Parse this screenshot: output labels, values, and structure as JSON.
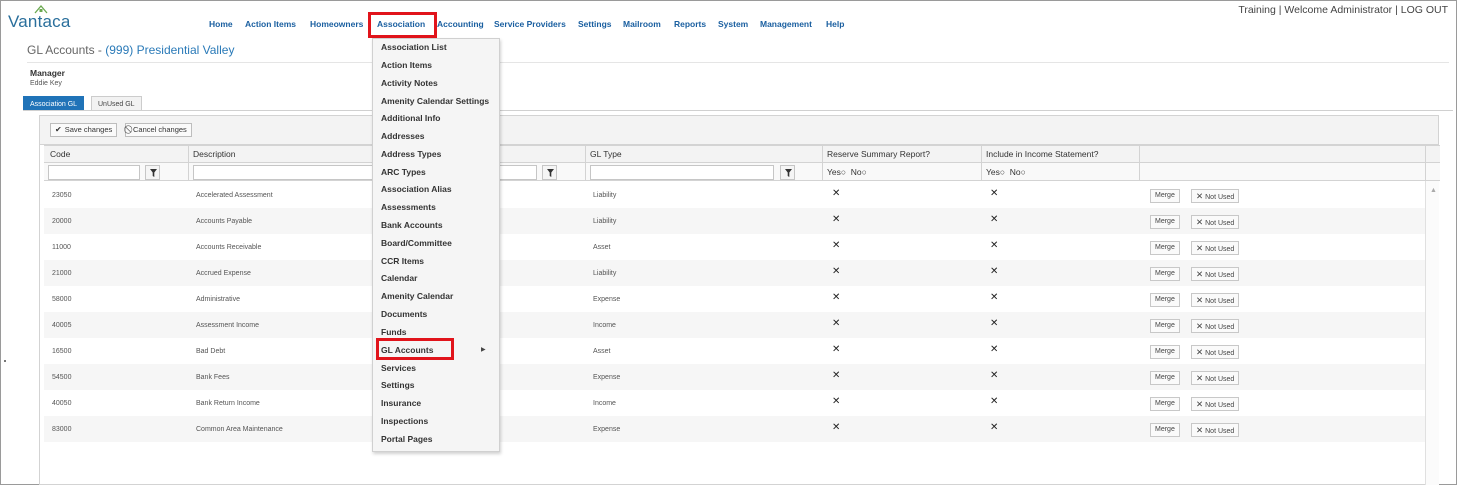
{
  "app": {
    "logo_text": "Vantaca"
  },
  "nav": {
    "items": [
      "Home",
      "Action Items",
      "Homeowners",
      "Association",
      "Accounting",
      "Service Providers",
      "Settings",
      "Mailroom",
      "Reports",
      "System",
      "Management",
      "Help"
    ],
    "active": "Association"
  },
  "user_bar": {
    "text": "Training | Welcome Administrator | LOG OUT"
  },
  "page": {
    "title_prefix": "GL Accounts - ",
    "association": "(999) Presidential Valley",
    "manager_label": "Manager",
    "manager_name": "Eddie Key"
  },
  "tabs": [
    "Association GL",
    "UnUsed GL"
  ],
  "toolbar": {
    "save_label": "Save changes",
    "cancel_label": "Cancel changes"
  },
  "grid": {
    "columns": [
      "Code",
      "Description",
      "GL Type",
      "Reserve Summary Report?",
      "Include in Income Statement?"
    ],
    "radio_yes": "Yes",
    "radio_no": "No",
    "merge_label": "Merge",
    "not_used_label": "Not Used",
    "rows": [
      {
        "code": "23050",
        "description": "Accelerated Assessment",
        "gl_type": "Liability",
        "reserve": "✕",
        "income": "✕"
      },
      {
        "code": "20000",
        "description": "Accounts Payable",
        "gl_type": "Liability",
        "reserve": "✕",
        "income": "✕"
      },
      {
        "code": "11000",
        "description": "Accounts Receivable",
        "gl_type": "Asset",
        "reserve": "✕",
        "income": "✕"
      },
      {
        "code": "21000",
        "description": "Accrued Expense",
        "gl_type": "Liability",
        "reserve": "✕",
        "income": "✕"
      },
      {
        "code": "58000",
        "description": "Administrative",
        "gl_type": "Expense",
        "reserve": "✕",
        "income": "✕"
      },
      {
        "code": "40005",
        "description": "Assessment Income",
        "gl_type": "Income",
        "reserve": "✕",
        "income": "✕"
      },
      {
        "code": "16500",
        "description": "Bad Debt",
        "gl_type": "Asset",
        "reserve": "✕",
        "income": "✕"
      },
      {
        "code": "54500",
        "description": "Bank Fees",
        "gl_type": "Expense",
        "reserve": "✕",
        "income": "✕"
      },
      {
        "code": "40050",
        "description": "Bank Return Income",
        "gl_type": "Income",
        "reserve": "✕",
        "income": "✕"
      },
      {
        "code": "83000",
        "description": "Common Area Maintenance",
        "gl_type": "Expense",
        "reserve": "✕",
        "income": "✕"
      }
    ]
  },
  "association_menu": {
    "items": [
      "Association List",
      "Action Items",
      "Activity Notes",
      "Amenity Calendar Settings",
      "Additional Info",
      "Addresses",
      "Address Types",
      "ARC Types",
      "Association Alias",
      "Assessments",
      "Bank Accounts",
      "Board/Committee",
      "CCR Items",
      "Calendar",
      "Amenity Calendar",
      "Documents",
      "Funds",
      "GL Accounts",
      "Services",
      "Settings",
      "Insurance",
      "Inspections",
      "Portal Pages"
    ],
    "highlighted": "GL Accounts"
  },
  "colors": {
    "accent": "#2073b8",
    "link": "#1a5fa0",
    "highlight_box": "#e1141b"
  }
}
